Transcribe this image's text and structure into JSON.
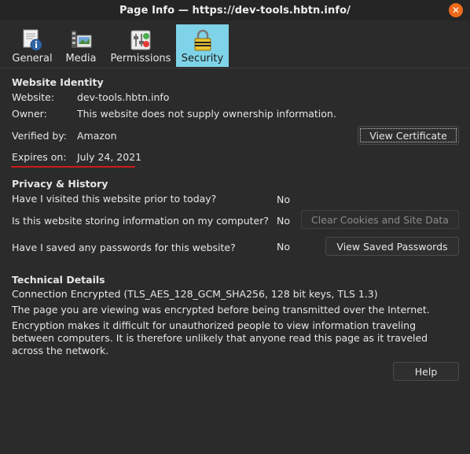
{
  "window": {
    "title": "Page Info — https://dev-tools.hbtn.info/",
    "close_icon": "close-icon"
  },
  "tabs": [
    {
      "label": "General",
      "icon": "info-page-icon",
      "selected": false
    },
    {
      "label": "Media",
      "icon": "media-icon",
      "selected": false
    },
    {
      "label": "Permissions",
      "icon": "permissions-icon",
      "selected": false
    },
    {
      "label": "Security",
      "icon": "lock-icon",
      "selected": true
    }
  ],
  "identity": {
    "title": "Website Identity",
    "website_label": "Website:",
    "website_value": "dev-tools.hbtn.info",
    "owner_label": "Owner:",
    "owner_value": "This website does not supply ownership information.",
    "verified_label": "Verified by:",
    "verified_value": "Amazon",
    "expires_label": "Expires on:",
    "expires_value": "July 24, 2021",
    "view_certificate": "View Certificate"
  },
  "privacy": {
    "title": "Privacy & History",
    "q1": "Have I visited this website prior to today?",
    "a1": "No",
    "q2": "Is this website storing information on my computer?",
    "a2": "No",
    "clear_cookies": "Clear Cookies and Site Data",
    "q3": "Have I saved any passwords for this website?",
    "a3": "No",
    "view_passwords": "View Saved Passwords"
  },
  "technical": {
    "title": "Technical Details",
    "line1": "Connection Encrypted (TLS_AES_128_GCM_SHA256, 128 bit keys, TLS 1.3)",
    "line2": "The page you are viewing was encrypted before being transmitted over the Internet.",
    "line3": "Encryption makes it difficult for unauthorized people to view information traveling between computers. It is therefore unlikely that anyone read this page as it traveled across the network."
  },
  "footer": {
    "help": "Help"
  },
  "colors": {
    "accent_selected_tab": "#7fd3e8",
    "close_button": "#f06a1a",
    "annotation_underline": "#d11a1a",
    "background": "#2b2b2b"
  }
}
